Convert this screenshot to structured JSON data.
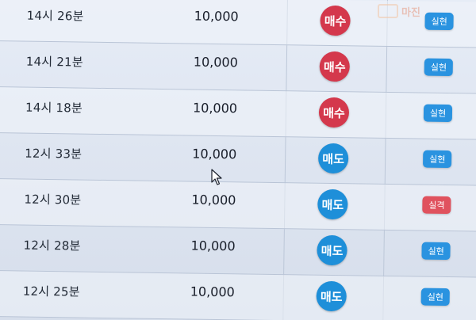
{
  "logo": {
    "text": "마진"
  },
  "rows": [
    {
      "time": "14시 26분",
      "amount": "10,000",
      "type": "매수",
      "kind": "buy",
      "result": "실현",
      "result_kind": "win"
    },
    {
      "time": "14시 21분",
      "amount": "10,000",
      "type": "매수",
      "kind": "buy",
      "result": "실현",
      "result_kind": "win"
    },
    {
      "time": "14시 18분",
      "amount": "10,000",
      "type": "매수",
      "kind": "buy",
      "result": "실현",
      "result_kind": "win"
    },
    {
      "time": "12시 33분",
      "amount": "10,000",
      "type": "매도",
      "kind": "sell",
      "result": "실현",
      "result_kind": "win"
    },
    {
      "time": "12시 30분",
      "amount": "10,000",
      "type": "매도",
      "kind": "sell",
      "result": "실격",
      "result_kind": "lose"
    },
    {
      "time": "12시 28분",
      "amount": "10,000",
      "type": "매도",
      "kind": "sell",
      "result": "실현",
      "result_kind": "win"
    },
    {
      "time": "12시 25분",
      "amount": "10,000",
      "type": "매도",
      "kind": "sell",
      "result": "실현",
      "result_kind": "win"
    }
  ],
  "colors": {
    "buy": "#d4384c",
    "sell": "#1e8fd9",
    "win": "#2a93e0",
    "lose": "#e0525e"
  },
  "icons": {
    "cursor": "mouse-pointer-icon",
    "logo": "logo-icon"
  }
}
